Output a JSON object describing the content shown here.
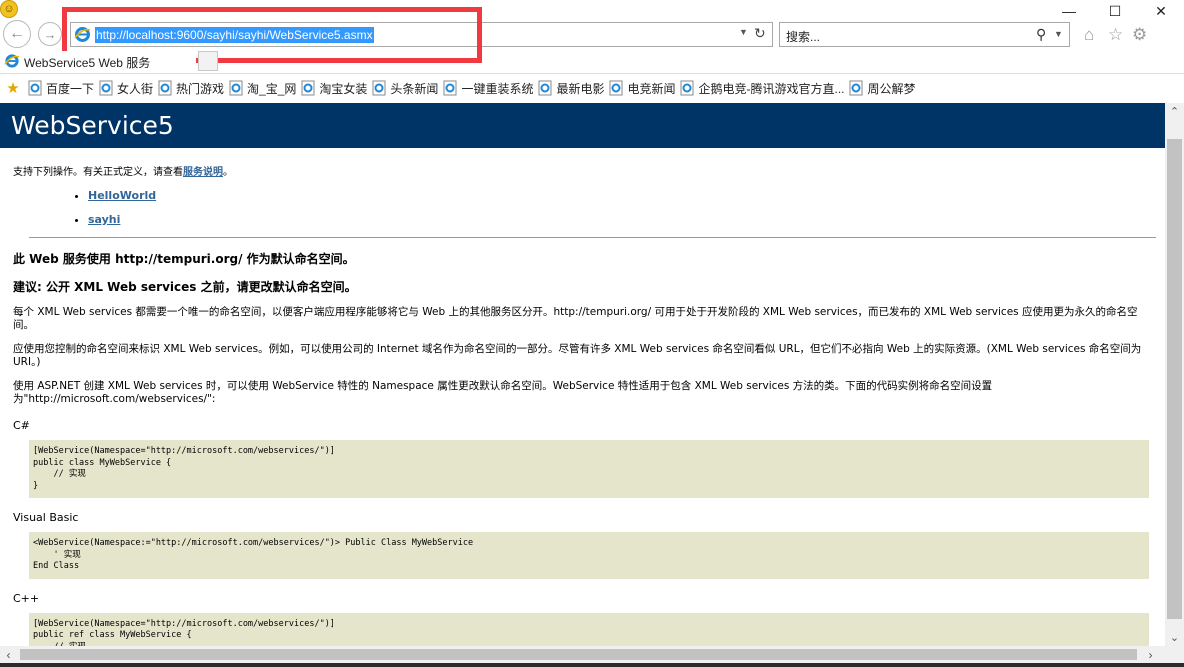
{
  "browser": {
    "url": "http://localhost:9600/sayhi/sayhi/WebService5.asmx",
    "search_placeholder": "搜索...",
    "tab_title": "WebService5 Web 服务",
    "window_controls": {
      "minimize": "—",
      "maximize": "☐",
      "close": "✕"
    },
    "favorites": [
      "百度一下",
      "女人街",
      "热门游戏",
      "淘_宝_网",
      "淘宝女装",
      "头条新闻",
      "一键重装系统",
      "最新电影",
      "电竞新闻",
      "企鹅电竞-腾讯游戏官方直...",
      "周公解梦"
    ],
    "highlight_color": "#ef3a41",
    "selection_color": "#3399ff"
  },
  "page": {
    "title": "WebService5",
    "header_color": "#003366",
    "link_color": "#336699",
    "intro_text": "支持下列操作。有关正式定义，请查看",
    "intro_link": "服务说明",
    "intro_end": "。",
    "operations": [
      "HelloWorld",
      "sayhi"
    ],
    "heading1": "此 Web 服务使用 http://tempuri.org/ 作为默认命名空间。",
    "heading2": "建议: 公开 XML Web services 之前，请更改默认命名空间。",
    "para1": "每个 XML Web services 都需要一个唯一的命名空间，以便客户端应用程序能够将它与 Web 上的其他服务区分开。http://tempuri.org/ 可用于处于开发阶段的 XML Web services，而已发布的 XML Web services 应使用更为永久的命名空间。",
    "para2": "应使用您控制的命名空间来标识 XML Web services。例如，可以使用公司的 Internet 域名作为命名空间的一部分。尽管有许多 XML Web services 命名空间看似 URL，但它们不必指向 Web 上的实际资源。(XML Web services 命名空间为 URI。)",
    "para3": "使用 ASP.NET 创建 XML Web services 时，可以使用 WebService 特性的 Namespace 属性更改默认命名空间。WebService 特性适用于包含 XML Web services 方法的类。下面的代码实例将命名空间设置为\"http://microsoft.com/webservices/\":",
    "code_examples": [
      {
        "lang": "C#",
        "code": "[WebService(Namespace=\"http://microsoft.com/webservices/\")]\npublic class MyWebService {\n    // 实现\n}"
      },
      {
        "lang": "Visual Basic",
        "code": "<WebService(Namespace:=\"http://microsoft.com/webservices/\")> Public Class MyWebService\n    ' 实现\nEnd Class"
      },
      {
        "lang": "C++",
        "code": "[WebService(Namespace=\"http://microsoft.com/webservices/\")]\npublic ref class MyWebService {\n    // 实现"
      }
    ],
    "code_bg": "#e5e5cc"
  }
}
